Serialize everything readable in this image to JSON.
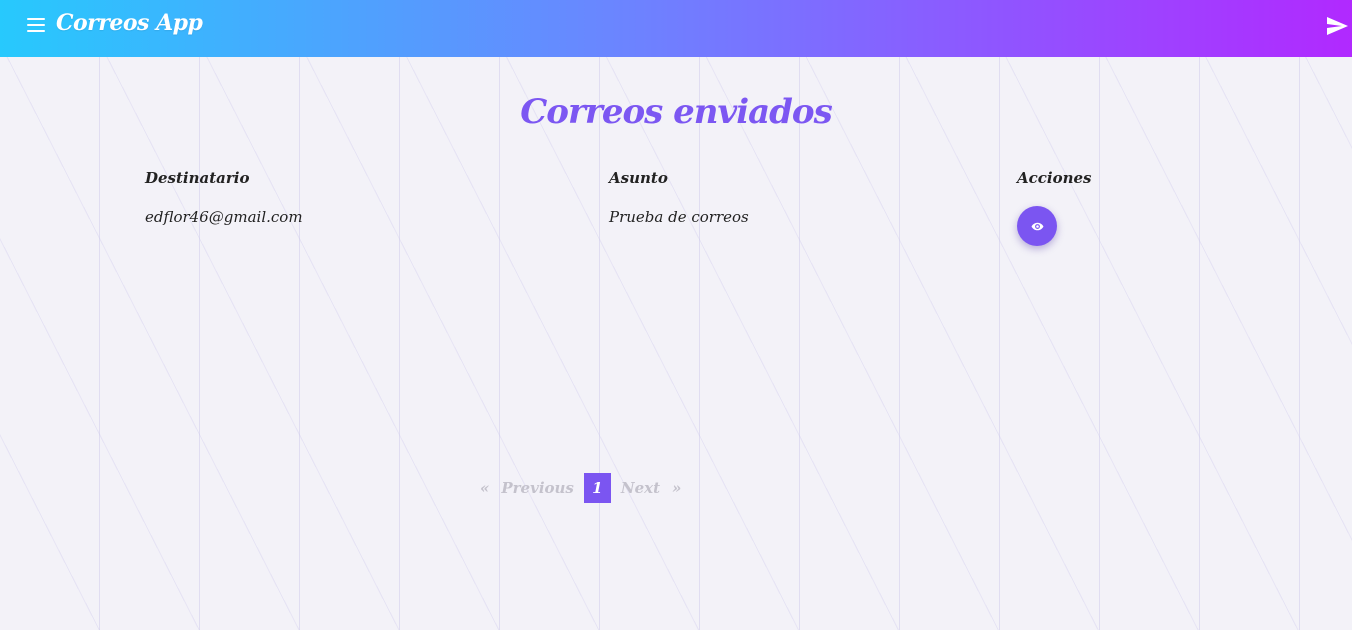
{
  "header": {
    "menu_icon": "hamburger-menu-icon",
    "app_title": "Correos App",
    "send_icon": "send-icon",
    "gradient": [
      "#27c9fd",
      "#6a86ff",
      "#b129ff"
    ]
  },
  "main": {
    "title": "Correos enviados",
    "accent_color": "#7b55f1",
    "table": {
      "columns": [
        "Destinatario",
        "Asunto",
        "Acciones"
      ],
      "rows": [
        {
          "recipient": "edflor46@gmail.com",
          "subject": "Prueba de correos",
          "action_icon": "eye-icon"
        }
      ]
    },
    "pagination": {
      "first": "«",
      "previous": "Previous",
      "current_page": "1",
      "next": "Next",
      "last": "»"
    }
  }
}
